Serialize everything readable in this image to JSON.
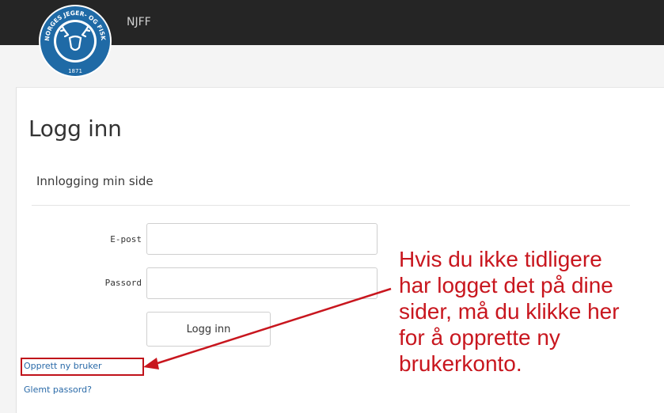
{
  "header": {
    "brand": "NJFF",
    "logo": {
      "ring_text": "NORGES JEGER- OG FISKERFORBUND",
      "year": "1871",
      "icon": "deer-fish-logo-icon"
    }
  },
  "login": {
    "title": "Logg inn",
    "subtitle": "Innlogging min side",
    "email_label": "E-post",
    "email_value": "",
    "password_label": "Passord",
    "password_value": "",
    "submit_label": "Logg inn",
    "create_account_link": "Opprett ny bruker",
    "forgot_password_link": "Glemt passord?"
  },
  "annotation": {
    "lines": [
      "Hvis du ikke tidligere",
      "har logget det på dine",
      "sider, må du klikke her",
      "for å opprette ny",
      "brukerkonto."
    ],
    "color": "#c8161e"
  },
  "colors": {
    "topbar": "#252525",
    "link": "#2a6aa8",
    "logo_blue": "#1f6aa6"
  }
}
